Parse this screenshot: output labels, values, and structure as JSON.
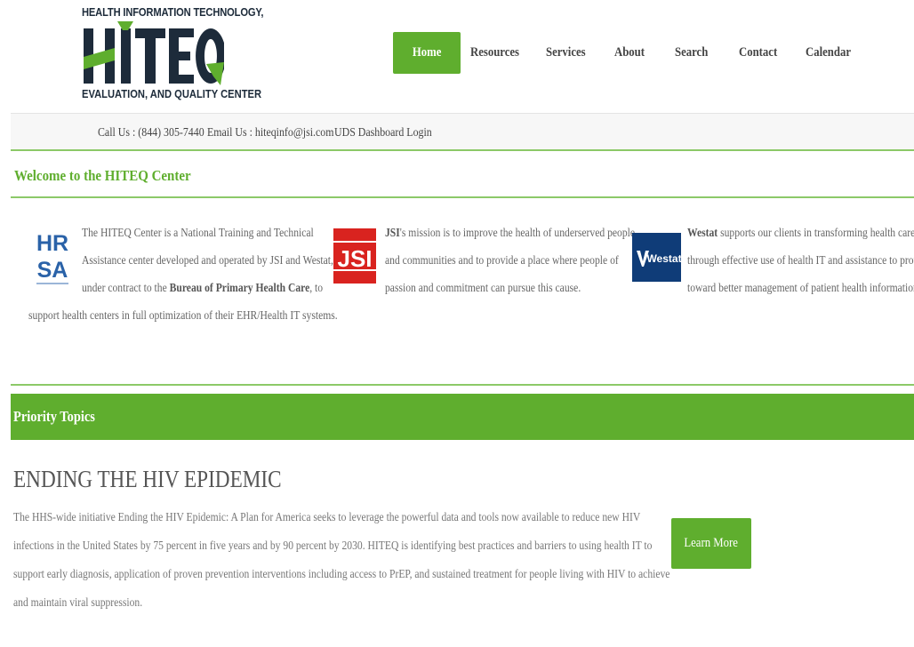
{
  "logo": {
    "line1": "HEALTH INFORMATION TECHNOLOGY,",
    "wordmark": "HITEQ",
    "line3": "EVALUATION, AND QUALITY CENTER"
  },
  "nav": {
    "items": [
      {
        "label": "Home",
        "active": true
      },
      {
        "label": "Resources"
      },
      {
        "label": "Services"
      },
      {
        "label": "About"
      },
      {
        "label": "Search"
      },
      {
        "label": "Contact"
      },
      {
        "label": "Calendar"
      }
    ]
  },
  "infobar": {
    "call": "Call Us : (844) 305-7440",
    "email": "Email Us : hiteqinfo@jsi.com",
    "uds": "UDS Dashboard Login"
  },
  "welcome": {
    "title": "Welcome to the HITEQ Center",
    "hrsa": {
      "logo_top": "HR",
      "logo_bottom": "SA",
      "l1": "The HITEQ Center is a National Training and Technical",
      "l2": "Assistance center developed and operated by JSI and Westat,",
      "l3_pre": "under contract to the ",
      "l3_bold": "Bureau of Primary Health Care",
      "l3_post": ", to",
      "l4": "support health centers in full optimization of their EHR/Health IT systems."
    },
    "jsi": {
      "logo": "JSI",
      "l1_bold": "JSI",
      "l1": "'s mission is to improve the health of underserved people",
      "l2": "and communities and to provide a place where people of",
      "l3": "passion and commitment can pursue this cause."
    },
    "westat": {
      "logo": "Westat",
      "l1_bold": "Westat",
      "l1": " supports our clients in transforming health care",
      "l2": "through effective use of health IT and assistance to providers",
      "l3": "toward better management of patient health information."
    }
  },
  "priority": {
    "header": "Priority Topics",
    "topic_title": "ENDING THE HIV EPIDEMIC",
    "body": [
      "The HHS-wide initiative Ending the HIV Epidemic: A Plan for America seeks to leverage the powerful data and tools now available to reduce new HIV",
      "infections in the United States by 75 percent in five years and by 90 percent by 2030. HITEQ is identifying best practices and barriers to using health IT to",
      "support early diagnosis, application of proven prevention interventions including access to PrEP, and sustained treatment for people living with HIV to achieve",
      "and maintain viral suppression."
    ],
    "learn_more": "Learn More"
  },
  "colors": {
    "accent_green": "#5fae2e",
    "rule_green": "#8cc968",
    "navy": "#1d2b3a",
    "jsi_red": "#d9231f",
    "westat_blue": "#0f3c78"
  },
  "icons": [
    "hiteq-logo",
    "hrsa-logo-icon",
    "jsi-logo-icon",
    "westat-logo-icon"
  ]
}
